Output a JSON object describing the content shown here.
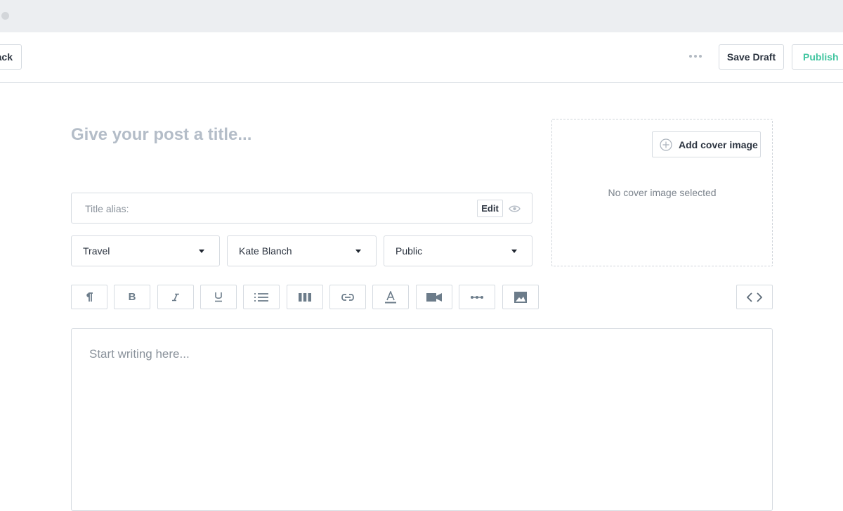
{
  "header": {
    "back_label": "Back",
    "save_draft_label": "Save Draft",
    "publish_label": "Publish",
    "more_icon": "more-horizontal-icon"
  },
  "post": {
    "title_value": "",
    "title_placeholder": "Give your post a title...",
    "alias_label": "Title alias:",
    "alias_edit_label": "Edit"
  },
  "selects": {
    "category": "Travel",
    "author": "Kate Blanch",
    "visibility": "Public"
  },
  "cover": {
    "add_label": "Add cover image",
    "empty_text": "No cover image selected"
  },
  "toolbar": {
    "items": [
      "paragraph-icon",
      "bold-icon",
      "italic-icon",
      "underline-icon",
      "list-icon",
      "columns-icon",
      "link-icon",
      "text-color-icon",
      "video-icon",
      "divider-icon",
      "image-icon"
    ],
    "code_icon": "code-icon"
  },
  "editor": {
    "placeholder": "Start writing here..."
  },
  "colors": {
    "accent": "#41c5a0",
    "border": "#d6dbe1",
    "placeholder": "#b4bdc8",
    "icon": "#6c7c8a"
  }
}
